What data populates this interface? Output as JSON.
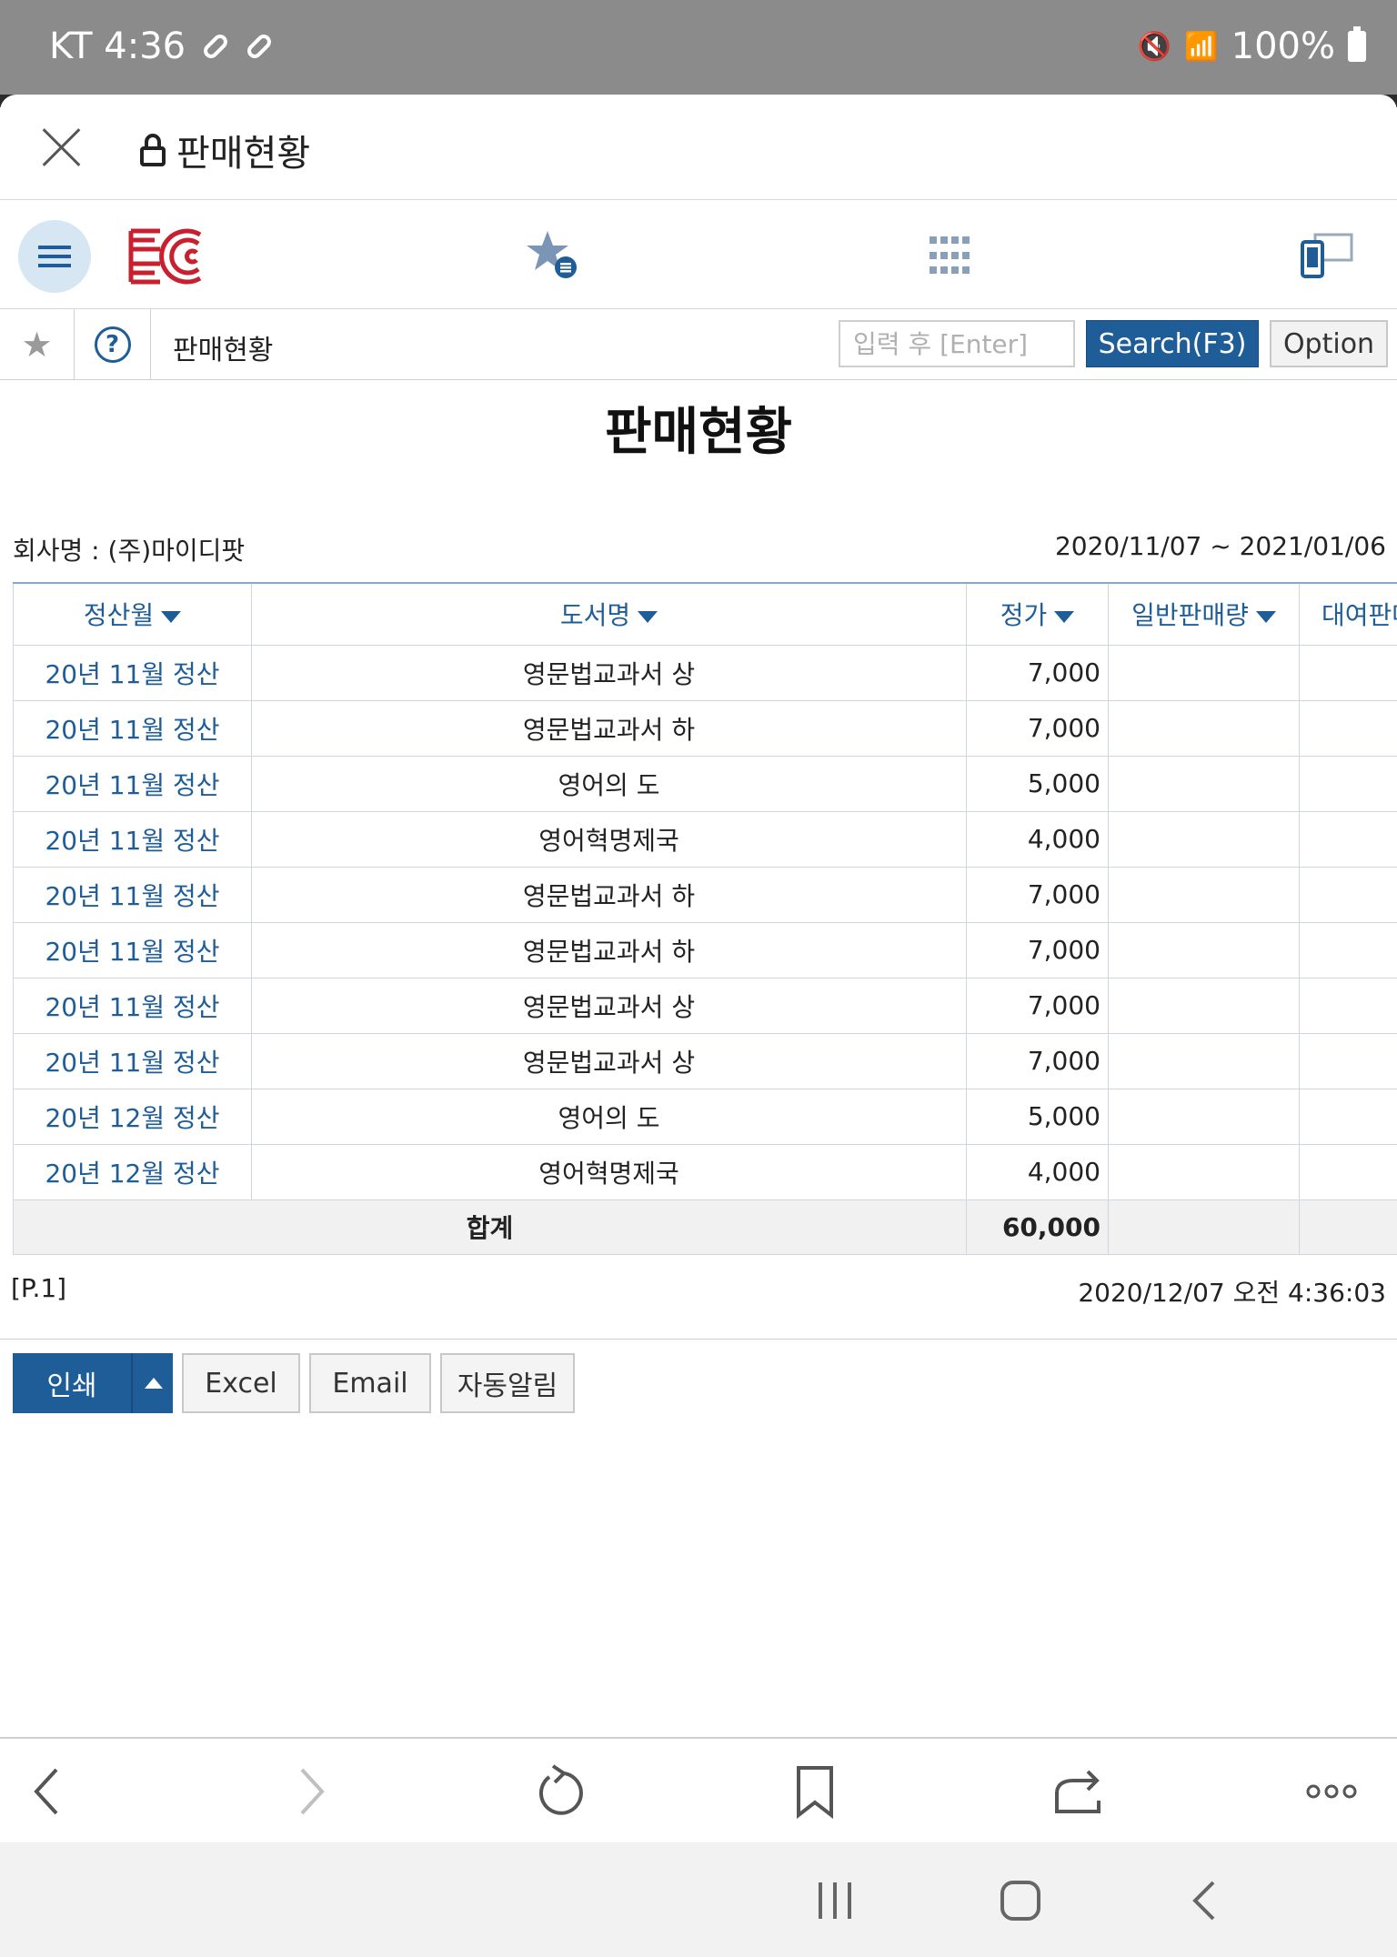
{
  "status_bar": {
    "carrier_time": "KT 4:36",
    "battery": "100%"
  },
  "header": {
    "title": "판매현황"
  },
  "toolbar": {
    "sub_title": "판매현황",
    "search_placeholder": "입력 후 [Enter]",
    "search_label": "Search(F3)",
    "option_label": "Option"
  },
  "report": {
    "title": "판매현황",
    "company": "회사명 : (주)마이디팟",
    "period": "2020/11/07 ~ 2021/01/06",
    "columns": [
      "정산월",
      "도서명",
      "정가",
      "일반판매량",
      "대여판매량"
    ],
    "rows": [
      {
        "month": "20년 11월 정산",
        "book": "영문법교과서 상",
        "price": "7,000"
      },
      {
        "month": "20년 11월 정산",
        "book": "영문법교과서 하",
        "price": "7,000"
      },
      {
        "month": "20년 11월 정산",
        "book": "영어의 도",
        "price": "5,000"
      },
      {
        "month": "20년 11월 정산",
        "book": "영어혁명제국",
        "price": "4,000"
      },
      {
        "month": "20년 11월 정산",
        "book": "영문법교과서 하",
        "price": "7,000"
      },
      {
        "month": "20년 11월 정산",
        "book": "영문법교과서 하",
        "price": "7,000"
      },
      {
        "month": "20년 11월 정산",
        "book": "영문법교과서 상",
        "price": "7,000"
      },
      {
        "month": "20년 11월 정산",
        "book": "영문법교과서 상",
        "price": "7,000"
      },
      {
        "month": "20년 12월 정산",
        "book": "영어의 도",
        "price": "5,000"
      },
      {
        "month": "20년 12월 정산",
        "book": "영어혁명제국",
        "price": "4,000"
      }
    ],
    "total_label": "합계",
    "total_value": "60,000",
    "page_no": "[P.1]",
    "printed_at": "2020/12/07 오전 4:36:03"
  },
  "actions": {
    "print": "인쇄",
    "excel": "Excel",
    "email": "Email",
    "auto_notify": "자동알림"
  },
  "colors": {
    "primary": "#1f5d99",
    "logo_red": "#c8202f",
    "accent_light": "#d6e6f3"
  }
}
